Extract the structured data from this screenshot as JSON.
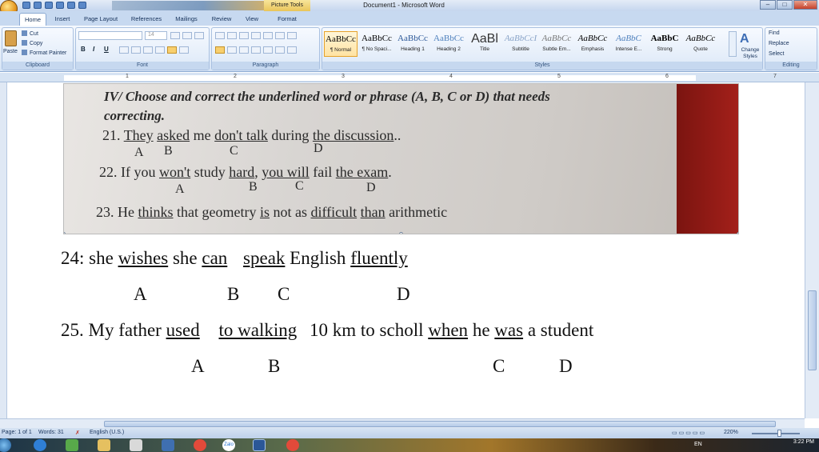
{
  "window": {
    "title": "Document1 - Microsoft Word",
    "context_tab": "Picture Tools",
    "buttons": [
      "–",
      "□",
      "✕"
    ]
  },
  "tabs": [
    {
      "label": "Home",
      "active": true
    },
    {
      "label": "Insert"
    },
    {
      "label": "Page Layout"
    },
    {
      "label": "References"
    },
    {
      "label": "Mailings"
    },
    {
      "label": "Review"
    },
    {
      "label": "View"
    },
    {
      "label": "Format"
    }
  ],
  "ribbon": {
    "clipboard": {
      "title": "Clipboard",
      "paste": "Paste",
      "cut": "Cut",
      "copy": "Copy",
      "format_painter": "Format Painter"
    },
    "font": {
      "title": "Font",
      "size": "14"
    },
    "paragraph": {
      "title": "Paragraph"
    },
    "styles": {
      "title": "Styles",
      "items": [
        {
          "preview": "AaBbCc",
          "name": "¶ Normal",
          "selected": true
        },
        {
          "preview": "AaBbCc",
          "name": "¶ No Spaci..."
        },
        {
          "preview": "AaBbCc",
          "name": "Heading 1"
        },
        {
          "preview": "AaBbCc",
          "name": "Heading 2"
        },
        {
          "preview": "AaBl",
          "name": "Title"
        },
        {
          "preview": "AaBbCcI",
          "name": "Subtitle"
        },
        {
          "preview": "AaBbCc",
          "name": "Subtle Em..."
        },
        {
          "preview": "AaBbCc",
          "name": "Emphasis"
        },
        {
          "preview": "AaBbC",
          "name": "Intense E..."
        },
        {
          "preview": "AaBbC",
          "name": "Strong"
        },
        {
          "preview": "AaBbCc",
          "name": "Quote"
        }
      ],
      "change_styles": "Change Styles"
    },
    "editing": {
      "title": "Editing",
      "find": "Find",
      "replace": "Replace",
      "select": "Select"
    }
  },
  "ruler": {
    "numbers": [
      "1",
      "2",
      "3",
      "4",
      "5",
      "6",
      "7"
    ]
  },
  "photo_text": {
    "heading": "IV/ Choose and correct the underlined word or phrase (A, B, C or D) that needs",
    "heading2": "correcting.",
    "q21": {
      "num": "21.",
      "parts": [
        "They",
        "asked",
        "me",
        "don't talk",
        "during",
        "the discussion",
        ".."
      ],
      "letters": [
        "A",
        "B",
        "C",
        "D"
      ]
    },
    "q22": {
      "num": "22.",
      "parts": [
        "If you",
        "won't",
        "study",
        "hard",
        ",",
        "you will",
        "fail",
        "the exam",
        "."
      ],
      "letters": [
        "A",
        "B",
        "C",
        "D"
      ]
    },
    "q23": {
      "num": "23.",
      "parts": [
        "He",
        "thinks",
        "that geometry",
        "is",
        "not as",
        "difficult",
        "than",
        "arithmetic"
      ]
    }
  },
  "document": {
    "q24": {
      "num": "24:",
      "parts": [
        "she",
        "wishes",
        "she",
        "can",
        "speak",
        "English",
        "fluently"
      ],
      "letters": [
        "A",
        "B",
        "C",
        "D"
      ]
    },
    "q25": {
      "num": "25.",
      "parts": [
        "My father",
        "used",
        "to walking",
        "10 km to scholl",
        "when",
        "he",
        "was",
        "a student"
      ],
      "letters": [
        "A",
        "B",
        "C",
        "D"
      ]
    }
  },
  "status": {
    "page": "Page: 1 of 1",
    "words": "Words: 31",
    "language": "English (U.S.)",
    "zoom": "220%"
  },
  "taskbar": {
    "lang": "EN",
    "time": "3:22 PM",
    "zalo": "Zalo"
  }
}
